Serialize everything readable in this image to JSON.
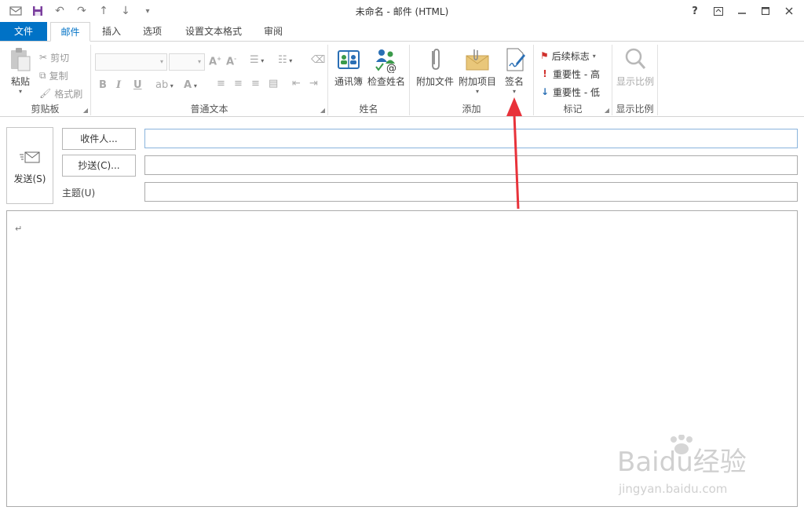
{
  "window": {
    "title": "未命名 - 邮件 (HTML)",
    "help": "?"
  },
  "tabs": [
    {
      "label": "文件"
    },
    {
      "label": "邮件"
    },
    {
      "label": "插入"
    },
    {
      "label": "选项"
    },
    {
      "label": "设置文本格式"
    },
    {
      "label": "审阅"
    }
  ],
  "ribbon": {
    "clipboard": {
      "label": "剪贴板",
      "paste": "粘贴",
      "cut": "剪切",
      "copy": "复制",
      "format_painter": "格式刷"
    },
    "basic_text": {
      "label": "普通文本",
      "bold": "B",
      "italic": "I",
      "underline": "U"
    },
    "names": {
      "label": "姓名",
      "address_book": "通讯簿",
      "check_names": "检查姓名"
    },
    "include": {
      "label": "添加",
      "attach_file": "附加文件",
      "attach_item": "附加项目",
      "signature": "签名"
    },
    "tags": {
      "label": "标记",
      "follow_up": "后续标志",
      "high": "重要性 - 高",
      "low": "重要性 - 低"
    },
    "zoom": {
      "label": "显示比例",
      "zoom": "显示比例"
    }
  },
  "compose": {
    "send": "发送(S)",
    "to": "收件人...",
    "cc": "抄送(C)...",
    "subject": "主题(U)",
    "to_value": "",
    "cc_value": "",
    "subject_value": "",
    "body_mark": "↵"
  },
  "annotation": {
    "color": "#e8323a"
  },
  "watermark": {
    "brand": "Baidu经验",
    "url": "jingyan.baidu.com"
  },
  "colors": {
    "accent": "#0072c6"
  }
}
